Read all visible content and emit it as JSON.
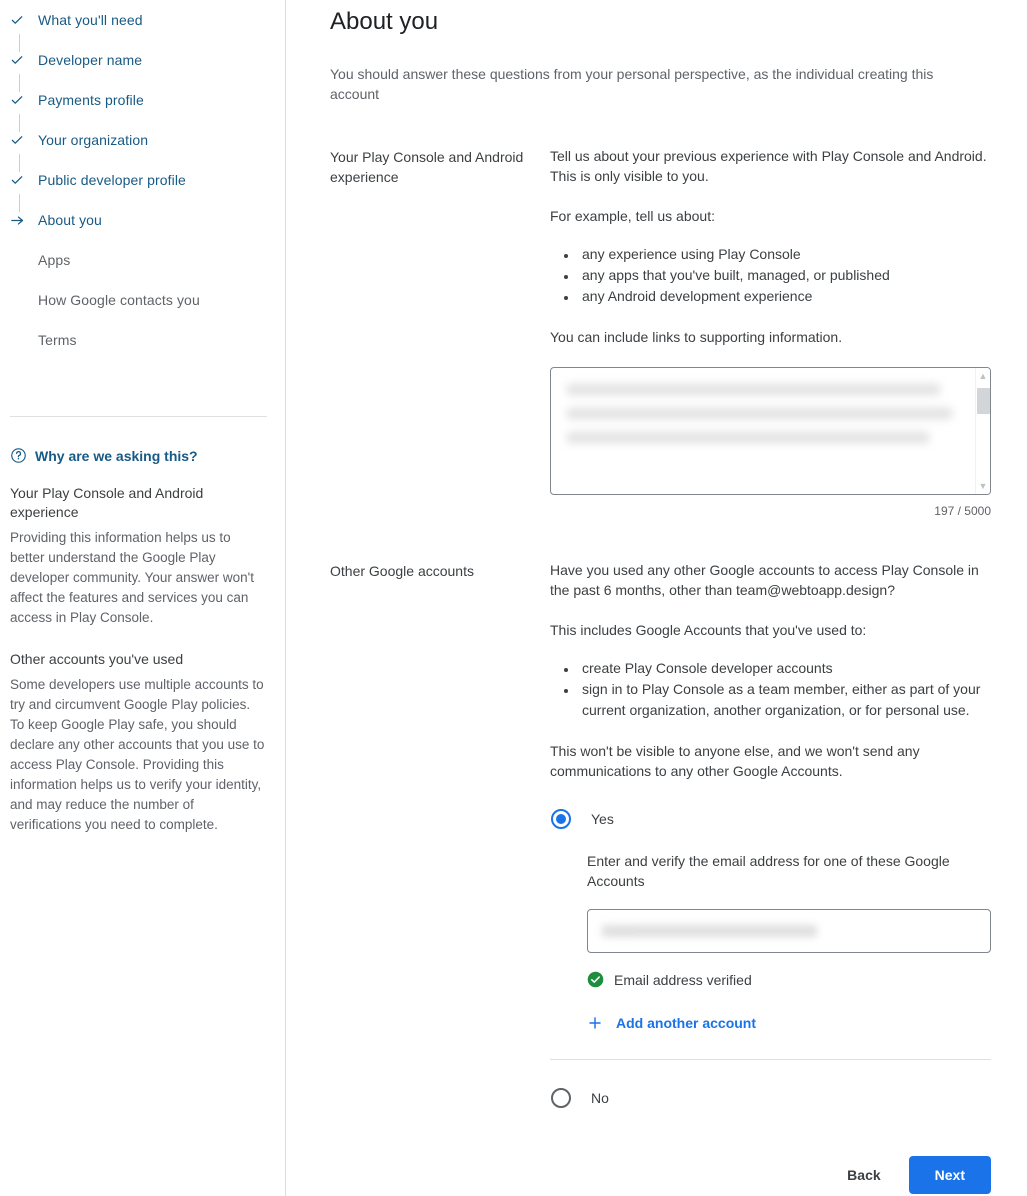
{
  "sidebar": {
    "steps": [
      {
        "label": "What you'll need",
        "state": "done",
        "icon": "check-icon"
      },
      {
        "label": "Developer name",
        "state": "done",
        "icon": "check-icon"
      },
      {
        "label": "Payments profile",
        "state": "done",
        "icon": "check-icon"
      },
      {
        "label": "Your organization",
        "state": "done",
        "icon": "check-icon"
      },
      {
        "label": "Public developer profile",
        "state": "done",
        "icon": "check-icon"
      },
      {
        "label": "About you",
        "state": "current",
        "icon": "arrow-right-icon"
      },
      {
        "label": "Apps",
        "state": "pending",
        "icon": ""
      },
      {
        "label": "How Google contacts you",
        "state": "pending",
        "icon": ""
      },
      {
        "label": "Terms",
        "state": "pending",
        "icon": ""
      }
    ],
    "help": {
      "title": "Why are we asking this?",
      "title_icon": "help-circle-icon",
      "sections": [
        {
          "heading": "Your Play Console and Android experience",
          "body": "Providing this information helps us to better understand the Google Play developer community. Your answer won't affect the features and services you can access in Play Console."
        },
        {
          "heading": "Other accounts you've used",
          "body": "Some developers use multiple accounts to try and circumvent Google Play policies. To keep Google Play safe, you should declare any other accounts that you use to access Play Console. Providing this information helps us to verify your identity, and may reduce the number of verifications you need to complete."
        }
      ]
    }
  },
  "main": {
    "title": "About you",
    "subtitle": "You should answer these questions from your personal perspective, as the individual creating this account",
    "experience": {
      "label": "Your Play Console and Android experience",
      "intro": "Tell us about your previous experience with Play Console and Android. This is only visible to you.",
      "example_intro": "For example, tell us about:",
      "examples": [
        "any experience using Play Console",
        "any apps that you've built, managed, or published",
        "any Android development experience"
      ],
      "links_note": "You can include links to supporting information.",
      "textarea_value": "",
      "char_count": "197 / 5000"
    },
    "other_accounts": {
      "label": "Other Google accounts",
      "question": "Have you used any other Google accounts to access Play Console in the past 6 months, other than team@webtoapp.design?",
      "includes_intro": "This includes Google Accounts that you've used to:",
      "includes": [
        "create Play Console developer accounts",
        "sign in to Play Console as a team member, either as part of your current organization, another organization, or for personal use."
      ],
      "privacy_note": "This won't be visible to anyone else, and we won't send any communications to any other Google Accounts.",
      "yes_label": "Yes",
      "no_label": "No",
      "selected": "Yes",
      "email_hint": "Enter and verify the email address for one of these Google Accounts",
      "email_value": "",
      "verified_label": "Email address verified",
      "verified_icon": "check-circle-icon",
      "add_account_label": "Add another account",
      "add_account_icon": "plus-icon"
    },
    "footer": {
      "back_label": "Back",
      "next_label": "Next"
    }
  },
  "colors": {
    "accent_blue": "#1a73e8",
    "step_blue": "#185a85",
    "verified_green": "#1e8e3e",
    "text_primary": "#202124",
    "text_secondary": "#5f6368",
    "divider": "#e0e0e0"
  }
}
